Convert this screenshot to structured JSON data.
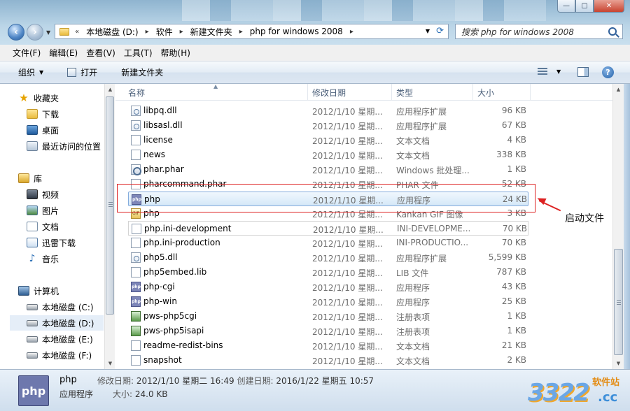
{
  "window": {
    "caption_buttons": [
      "—",
      "▢",
      "✕"
    ]
  },
  "address": {
    "crumbs": [
      "本地磁盘 (D:)",
      "软件",
      "新建文件夹",
      "php for windows 2008"
    ],
    "search_placeholder": "搜索 php for windows 2008"
  },
  "menu": [
    "文件(F)",
    "编辑(E)",
    "查看(V)",
    "工具(T)",
    "帮助(H)"
  ],
  "toolbar": {
    "organize": "组织",
    "open": "打开",
    "new_folder": "新建文件夹"
  },
  "nav": {
    "favorites": "收藏夹",
    "downloads": "下载",
    "desktop": "桌面",
    "recent": "最近访问的位置",
    "libraries": "库",
    "videos": "视频",
    "pictures": "图片",
    "documents": "文档",
    "xunlei": "迅雷下载",
    "music": "音乐",
    "computer": "计算机",
    "drive_c": "本地磁盘 (C:)",
    "drive_d": "本地磁盘 (D:)",
    "drive_e": "本地磁盘 (E:)",
    "drive_f": "本地磁盘 (F:)"
  },
  "columns": {
    "name": "名称",
    "date": "修改日期",
    "type": "类型",
    "size": "大小"
  },
  "files": [
    {
      "name": "libpq.dll",
      "date": "2012/1/10 星期...",
      "type": "应用程序扩展",
      "size": "96 KB",
      "icon": "dll-icon"
    },
    {
      "name": "libsasl.dll",
      "date": "2012/1/10 星期...",
      "type": "应用程序扩展",
      "size": "67 KB",
      "icon": "dll-icon"
    },
    {
      "name": "license",
      "date": "2012/1/10 星期...",
      "type": "文本文档",
      "size": "4 KB",
      "icon": "text-file-icon"
    },
    {
      "name": "news",
      "date": "2012/1/10 星期...",
      "type": "文本文档",
      "size": "338 KB",
      "icon": "text-file-icon"
    },
    {
      "name": "phar.phar",
      "date": "2012/1/10 星期...",
      "type": "Windows 批处理...",
      "size": "1 KB",
      "icon": "batch-file-icon"
    },
    {
      "name": "pharcommand.phar",
      "date": "2012/1/10 星期...",
      "type": "PHAR 文件",
      "size": "52 KB",
      "icon": "file-icon"
    },
    {
      "name": "php",
      "date": "2012/1/10 星期...",
      "type": "应用程序",
      "size": "24 KB",
      "icon": "php-exe-icon"
    },
    {
      "name": "php",
      "date": "2012/1/10 星期...",
      "type": "Kankan GIF 图像",
      "size": "3 KB",
      "icon": "gif-image-icon"
    },
    {
      "name": "php.ini-development",
      "date": "2012/1/10 星期...",
      "type": "INI-DEVELOPME...",
      "size": "70 KB",
      "icon": "file-icon"
    },
    {
      "name": "php.ini-production",
      "date": "2012/1/10 星期...",
      "type": "INI-PRODUCTIO...",
      "size": "70 KB",
      "icon": "file-icon"
    },
    {
      "name": "php5.dll",
      "date": "2012/1/10 星期...",
      "type": "应用程序扩展",
      "size": "5,599 KB",
      "icon": "dll-icon"
    },
    {
      "name": "php5embed.lib",
      "date": "2012/1/10 星期...",
      "type": "LIB 文件",
      "size": "787 KB",
      "icon": "file-icon"
    },
    {
      "name": "php-cgi",
      "date": "2012/1/10 星期...",
      "type": "应用程序",
      "size": "43 KB",
      "icon": "php-exe-icon"
    },
    {
      "name": "php-win",
      "date": "2012/1/10 星期...",
      "type": "应用程序",
      "size": "25 KB",
      "icon": "php-exe-icon"
    },
    {
      "name": "pws-php5cgi",
      "date": "2012/1/10 星期...",
      "type": "注册表项",
      "size": "1 KB",
      "icon": "registry-file-icon"
    },
    {
      "name": "pws-php5isapi",
      "date": "2012/1/10 星期...",
      "type": "注册表项",
      "size": "1 KB",
      "icon": "registry-file-icon"
    },
    {
      "name": "readme-redist-bins",
      "date": "2012/1/10 星期...",
      "type": "文本文档",
      "size": "21 KB",
      "icon": "text-file-icon"
    },
    {
      "name": "snapshot",
      "date": "2012/1/10 星期...",
      "type": "文本文档",
      "size": "2 KB",
      "icon": "text-file-icon"
    }
  ],
  "selected_index": 6,
  "annotation": {
    "label": "启动文件",
    "color": "#dd2222"
  },
  "details": {
    "icon_text": "php",
    "name": "php",
    "type": "应用程序",
    "modified_label": "修改日期:",
    "modified": "2012/1/10 星期二 16:49",
    "created_label": "创建日期:",
    "created": "2016/1/22 星期五 10:57",
    "size_label": "大小:",
    "size": "24.0 KB"
  },
  "watermark": {
    "number": "3322",
    "domain": ".cc",
    "site": "软件站"
  }
}
